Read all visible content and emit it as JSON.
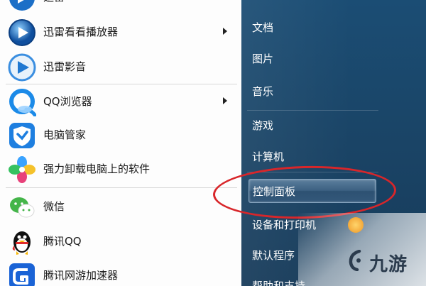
{
  "left_menu": {
    "items": [
      {
        "label": "迅雷",
        "icon": "xunlei-icon",
        "has_submenu": false
      },
      {
        "label": "迅雷看看播放器",
        "icon": "xunlei-kankan-player-icon",
        "has_submenu": true
      },
      {
        "label": "迅雷影音",
        "icon": "xunlei-yingyin-icon",
        "has_submenu": false
      },
      {
        "label": "QQ浏览器",
        "icon": "qq-browser-icon",
        "has_submenu": true
      },
      {
        "label": "电脑管家",
        "icon": "pc-manager-shield-icon",
        "has_submenu": false
      },
      {
        "label": "强力卸载电脑上的软件",
        "icon": "uninstaller-petals-icon",
        "has_submenu": false
      },
      {
        "label": "微信",
        "icon": "wechat-icon",
        "has_submenu": false
      },
      {
        "label": "腾讯QQ",
        "icon": "qq-penguin-icon",
        "has_submenu": false
      },
      {
        "label": "腾讯网游加速器",
        "icon": "game-accelerator-icon",
        "has_submenu": false
      }
    ]
  },
  "right_menu": {
    "items": [
      {
        "label": "文档"
      },
      {
        "label": "图片"
      },
      {
        "label": "音乐"
      },
      {
        "label": "游戏"
      },
      {
        "label": "计算机"
      },
      {
        "label": "控制面板",
        "highlighted": true
      },
      {
        "label": "设备和打印机"
      },
      {
        "label": "默认程序"
      },
      {
        "label": "帮助和支持"
      }
    ]
  },
  "annotation": {
    "color": "#d8262a",
    "shape": "red-ellipse-around-control-panel"
  },
  "watermark": {
    "text": "九游",
    "logo": "jiuyou-logo-icon"
  },
  "colors": {
    "right_panel": "#1a4466",
    "highlight": "#3c6182",
    "left_panel": "#fdfdfd"
  }
}
